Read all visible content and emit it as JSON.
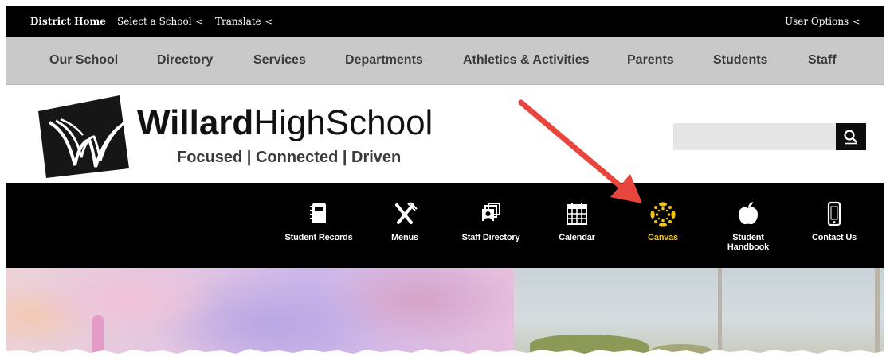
{
  "topbar": {
    "district_home": "District Home",
    "select_school": "Select a School",
    "translate": "Translate",
    "user_options": "User Options",
    "caret": "<"
  },
  "nav": {
    "items": [
      "Our School",
      "Directory",
      "Services",
      "Departments",
      "Athletics & Activities",
      "Parents",
      "Students",
      "Staff"
    ]
  },
  "header": {
    "logo_bold": "Willard",
    "logo_regular": "HighSchool",
    "tagline": "Focused | Connected | Driven",
    "search_placeholder": ""
  },
  "quicklinks": [
    {
      "label": "Student Records",
      "icon": "notebook-icon"
    },
    {
      "label": "Menus",
      "icon": "utensils-icon"
    },
    {
      "label": "Staff Directory",
      "icon": "staff-directory-icon"
    },
    {
      "label": "Calendar",
      "icon": "calendar-icon"
    },
    {
      "label": "Canvas",
      "icon": "canvas-logo-icon"
    },
    {
      "label": "Student Handbook",
      "icon": "apple-icon"
    },
    {
      "label": "Contact Us",
      "icon": "smartphone-icon"
    }
  ],
  "colors": {
    "topbar_bg": "#000000",
    "nav_bg": "#c9c9c9",
    "quickbar_bg": "#000000",
    "canvas_accent": "#f2c411",
    "annotation_arrow": "#e8453c"
  }
}
